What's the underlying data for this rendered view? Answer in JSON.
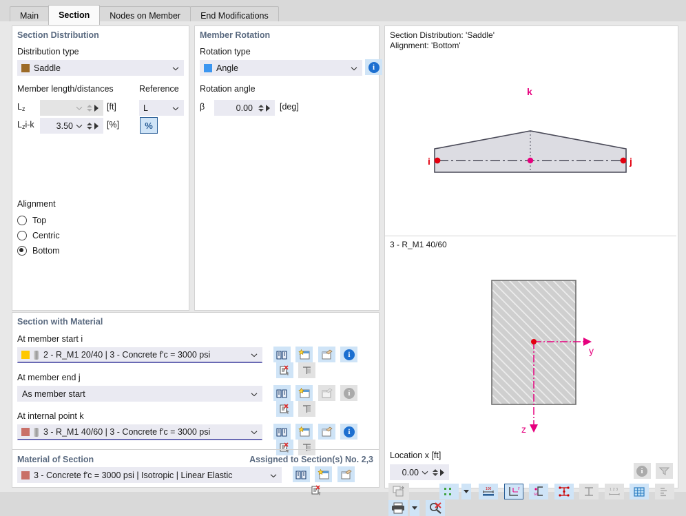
{
  "tabs": [
    {
      "label": "Main",
      "active": false
    },
    {
      "label": "Section",
      "active": true
    },
    {
      "label": "Nodes on Member",
      "active": false
    },
    {
      "label": "End Modifications",
      "active": false
    }
  ],
  "section_distribution": {
    "title": "Section Distribution",
    "distribution_type_label": "Distribution type",
    "distribution_type_value": "Saddle",
    "distribution_type_color": "#9C6B28",
    "member_length_label": "Member length/distances",
    "reference_label": "Reference",
    "rows": [
      {
        "symbol": "L",
        "sub": "z",
        "value": "",
        "unit": "[ft]",
        "disabled": true
      },
      {
        "symbol": "L",
        "sub": "z",
        "suffix": "i-k",
        "value": "3.50",
        "unit": "[%]",
        "disabled": false
      }
    ],
    "reference_value": "L",
    "percent_toggle": "%",
    "alignment_label": "Alignment",
    "alignment_options": [
      {
        "label": "Top",
        "selected": false
      },
      {
        "label": "Centric",
        "selected": false
      },
      {
        "label": "Bottom",
        "selected": true
      }
    ]
  },
  "member_rotation": {
    "title": "Member Rotation",
    "rotation_type_label": "Rotation type",
    "rotation_type_value": "Angle",
    "rotation_type_color": "#3C96F0",
    "rotation_angle_label": "Rotation angle",
    "beta_symbol": "β",
    "beta_value": "0.00",
    "beta_unit": "[deg]"
  },
  "section_with_material": {
    "title": "Section with Material",
    "assigned_label": "Assigned to Section(s) No. 2,3",
    "rows": [
      {
        "label": "At member start i",
        "value": "2 - R_M1 20/40 | 3 - Concrete f'c = 3000 psi",
        "color": "#FFC800",
        "has_swatch": true,
        "buttons_enabled": [
          true,
          true,
          true,
          true,
          true,
          false
        ],
        "underline": false
      },
      {
        "label": "At member end j",
        "value": "As member start",
        "color": "",
        "has_swatch": false,
        "buttons_enabled": [
          true,
          true,
          false,
          false,
          true,
          false
        ],
        "underline": false
      },
      {
        "label": "At internal point k",
        "value": "3 - R_M1 40/60 | 3 - Concrete f'c = 3000 psi",
        "color": "#C97068",
        "has_swatch": true,
        "buttons_enabled": [
          true,
          true,
          true,
          true,
          true,
          false
        ],
        "underline": true
      }
    ],
    "row_icons": [
      "book-icon",
      "new-section-icon",
      "edit-section-icon",
      "info-icon",
      "delete-section-icon",
      "section-properties-icon"
    ]
  },
  "material_of_section": {
    "title": "Material of Section",
    "value": "3 - Concrete f'c = 3000 psi | Isotropic | Linear Elastic",
    "color": "#C97068",
    "icons": [
      "book-icon",
      "new-material-icon",
      "edit-material-icon",
      "delete-material-icon"
    ]
  },
  "graphic_top": {
    "line1": "Section Distribution: 'Saddle'",
    "line2": "Alignment: 'Bottom'",
    "node_i": "i",
    "node_j": "j",
    "node_k": "k"
  },
  "graphic_bottom": {
    "title": "3 - R_M1 40/60",
    "axis_y": "y",
    "axis_z": "z"
  },
  "location": {
    "label": "Location x [ft]",
    "value": "0.00"
  },
  "bottom_toolbar": {
    "right_icons": [
      "info-icon",
      "filter-icon"
    ],
    "tools": [
      {
        "name": "export-view-icon",
        "state": "plain"
      },
      {
        "name": "points-display-icon",
        "state": "on",
        "caret": true
      },
      {
        "name": "dimensions-icon",
        "state": "on"
      },
      {
        "name": "axis-system-icon",
        "state": "selected"
      },
      {
        "name": "shear-center-icon",
        "state": "on"
      },
      {
        "name": "stress-points-icon",
        "state": "on"
      },
      {
        "name": "section-outline-icon",
        "state": "off"
      },
      {
        "name": "numbering-icon",
        "state": "off"
      },
      {
        "name": "grid-icon",
        "state": "on"
      },
      {
        "name": "mesh-icon",
        "state": "off"
      },
      {
        "name": "print-icon",
        "state": "on",
        "caret": true
      },
      {
        "name": "zoom-reset-icon",
        "state": "on"
      }
    ]
  },
  "colors": {
    "accent_blue": "#2a5e96",
    "group_title": "#5a6a80",
    "magenta": "#E6007E",
    "red_node": "#E3000F",
    "panel_bg": "#ffffff",
    "window_bg": "#e8e8e8"
  }
}
